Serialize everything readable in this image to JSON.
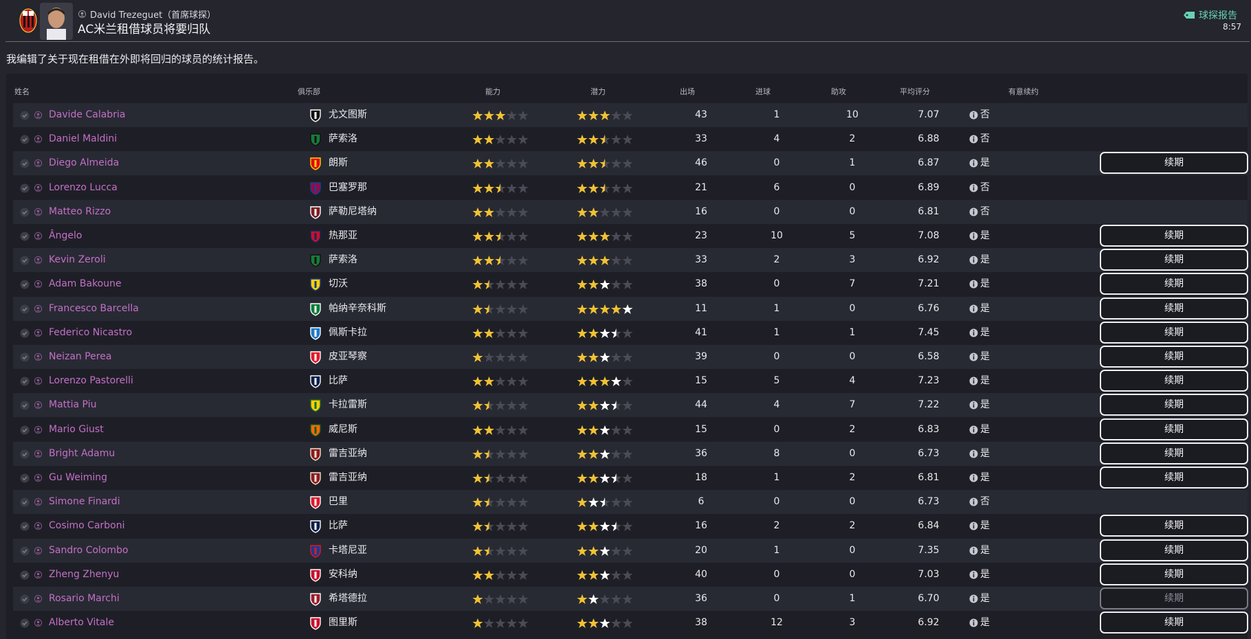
{
  "header": {
    "sender": "David Trezeguet（首席球探）",
    "subject": "AC米兰租借球员将要归队",
    "report_link": "球探报告",
    "time": "8:57"
  },
  "intro": "我编辑了关于现在租借在外即将回归的球员的统计报告。",
  "columns": {
    "name": "姓名",
    "club": "俱乐部",
    "ability": "能力",
    "potential": "潜力",
    "apps": "出场",
    "goals": "进球",
    "assists": "助攻",
    "avg": "平均评分",
    "renew_intent": "有意续约"
  },
  "renew_label": "续期",
  "colors": {
    "star": "#f1c232",
    "star_empty": "#4a4b55",
    "star_white": "#ffffff",
    "name": "#c46fc8",
    "accent": "#68d1b3"
  },
  "players": [
    {
      "name": "Davide Calabria",
      "club": "尤文图斯",
      "badge": "juventus",
      "cur": 3,
      "pot": 3,
      "pot_white": 0,
      "apps": "43",
      "goals": "1",
      "ast": "10",
      "avg": "7.07",
      "yn": "否",
      "renew": false
    },
    {
      "name": "Daniel Maldini",
      "club": "萨索洛",
      "badge": "sassuolo",
      "cur": 2,
      "pot": 2.5,
      "pot_white": 0,
      "apps": "33",
      "goals": "4",
      "ast": "2",
      "avg": "6.88",
      "yn": "否",
      "renew": false
    },
    {
      "name": "Diego Almeida",
      "club": "朗斯",
      "badge": "lens",
      "cur": 2,
      "pot": 2.5,
      "pot_white": 0,
      "apps": "46",
      "goals": "0",
      "ast": "1",
      "avg": "6.87",
      "yn": "是",
      "renew": true
    },
    {
      "name": "Lorenzo Lucca",
      "club": "巴塞罗那",
      "badge": "barcelona",
      "cur": 2.5,
      "pot": 2.5,
      "pot_white": 0,
      "apps": "21",
      "goals": "6",
      "ast": "0",
      "avg": "6.89",
      "yn": "否",
      "renew": false
    },
    {
      "name": "Matteo Rizzo",
      "club": "萨勒尼塔纳",
      "badge": "salernitana",
      "cur": 2,
      "pot": 2,
      "pot_white": 0,
      "apps": "16",
      "goals": "0",
      "ast": "0",
      "avg": "6.81",
      "yn": "否",
      "renew": false
    },
    {
      "name": "Ângelo",
      "club": "热那亚",
      "badge": "genoa",
      "cur": 2.5,
      "pot": 3,
      "pot_white": 0,
      "apps": "23",
      "goals": "10",
      "ast": "5",
      "avg": "7.08",
      "yn": "是",
      "renew": true
    },
    {
      "name": "Kevin Zeroli",
      "club": "萨索洛",
      "badge": "sassuolo",
      "cur": 2.5,
      "pot": 3,
      "pot_white": 0,
      "apps": "33",
      "goals": "2",
      "ast": "3",
      "avg": "6.92",
      "yn": "是",
      "renew": true
    },
    {
      "name": "Adam Bakoune",
      "club": "切沃",
      "badge": "chievo",
      "cur": 1.5,
      "pot": 2,
      "pot_white": 1,
      "apps": "38",
      "goals": "0",
      "ast": "7",
      "avg": "7.21",
      "yn": "是",
      "renew": true
    },
    {
      "name": "Francesco Barcella",
      "club": "帕纳辛奈科斯",
      "badge": "panathinaikos",
      "cur": 1.5,
      "pot": 4,
      "pot_white": 1,
      "apps": "11",
      "goals": "1",
      "ast": "0",
      "avg": "6.76",
      "yn": "是",
      "renew": true
    },
    {
      "name": "Federico Nicastro",
      "club": "佩斯卡拉",
      "badge": "pescara",
      "cur": 2,
      "pot": 2,
      "pot_white": 1.5,
      "apps": "41",
      "goals": "1",
      "ast": "1",
      "avg": "7.45",
      "yn": "是",
      "renew": true
    },
    {
      "name": "Neizan Perea",
      "club": "皮亚琴察",
      "badge": "piacenza",
      "cur": 1,
      "pot": 2,
      "pot_white": 1,
      "apps": "39",
      "goals": "0",
      "ast": "0",
      "avg": "6.58",
      "yn": "是",
      "renew": true
    },
    {
      "name": "Lorenzo Pastorelli",
      "club": "比萨",
      "badge": "pisa",
      "cur": 2,
      "pot": 3,
      "pot_white": 1,
      "apps": "15",
      "goals": "5",
      "ast": "4",
      "avg": "7.23",
      "yn": "是",
      "renew": true
    },
    {
      "name": "Mattia Piu",
      "club": "卡拉雷斯",
      "badge": "carrarese",
      "cur": 1.5,
      "pot": 2,
      "pot_white": 1.5,
      "apps": "44",
      "goals": "4",
      "ast": "7",
      "avg": "7.22",
      "yn": "是",
      "renew": true
    },
    {
      "name": "Mario Giust",
      "club": "威尼斯",
      "badge": "venezia",
      "cur": 2,
      "pot": 2,
      "pot_white": 1,
      "apps": "15",
      "goals": "0",
      "ast": "2",
      "avg": "6.83",
      "yn": "是",
      "renew": true
    },
    {
      "name": "Bright Adamu",
      "club": "雷吉亚纳",
      "badge": "reggiana",
      "cur": 1.5,
      "pot": 2,
      "pot_white": 1,
      "apps": "36",
      "goals": "8",
      "ast": "0",
      "avg": "6.73",
      "yn": "是",
      "renew": true
    },
    {
      "name": "Gu Weiming",
      "club": "雷吉亚纳",
      "badge": "reggiana",
      "cur": 1.5,
      "pot": 2,
      "pot_white": 1.5,
      "apps": "18",
      "goals": "1",
      "ast": "2",
      "avg": "6.81",
      "yn": "是",
      "renew": true
    },
    {
      "name": "Simone Finardi",
      "club": "巴里",
      "badge": "bari",
      "cur": 1.5,
      "pot": 1,
      "pot_white": 1.5,
      "apps": "6",
      "goals": "0",
      "ast": "0",
      "avg": "6.73",
      "yn": "否",
      "renew": false
    },
    {
      "name": "Cosimo Carboni",
      "club": "比萨",
      "badge": "pisa",
      "cur": 1.5,
      "pot": 2,
      "pot_white": 1.5,
      "apps": "16",
      "goals": "2",
      "ast": "2",
      "avg": "6.84",
      "yn": "是",
      "renew": true
    },
    {
      "name": "Sandro Colombo",
      "club": "卡塔尼亚",
      "badge": "catania",
      "cur": 1.5,
      "pot": 2,
      "pot_white": 1,
      "apps": "20",
      "goals": "1",
      "ast": "0",
      "avg": "7.35",
      "yn": "是",
      "renew": true
    },
    {
      "name": "Zheng Zhenyu",
      "club": "安科纳",
      "badge": "ancona",
      "cur": 2,
      "pot": 2,
      "pot_white": 1,
      "apps": "40",
      "goals": "0",
      "ast": "0",
      "avg": "7.03",
      "yn": "是",
      "renew": true
    },
    {
      "name": "Rosario Marchi",
      "club": "希塔德拉",
      "badge": "cittadella",
      "cur": 1,
      "pot": 1,
      "pot_white": 1,
      "apps": "36",
      "goals": "0",
      "ast": "1",
      "avg": "6.70",
      "yn": "是",
      "renew": true,
      "renew_dim": true
    },
    {
      "name": "Alberto Vitale",
      "club": "图里斯",
      "badge": "turris",
      "cur": 1,
      "pot": 2,
      "pot_white": 1,
      "apps": "38",
      "goals": "12",
      "ast": "3",
      "avg": "6.92",
      "yn": "是",
      "renew": true
    }
  ]
}
